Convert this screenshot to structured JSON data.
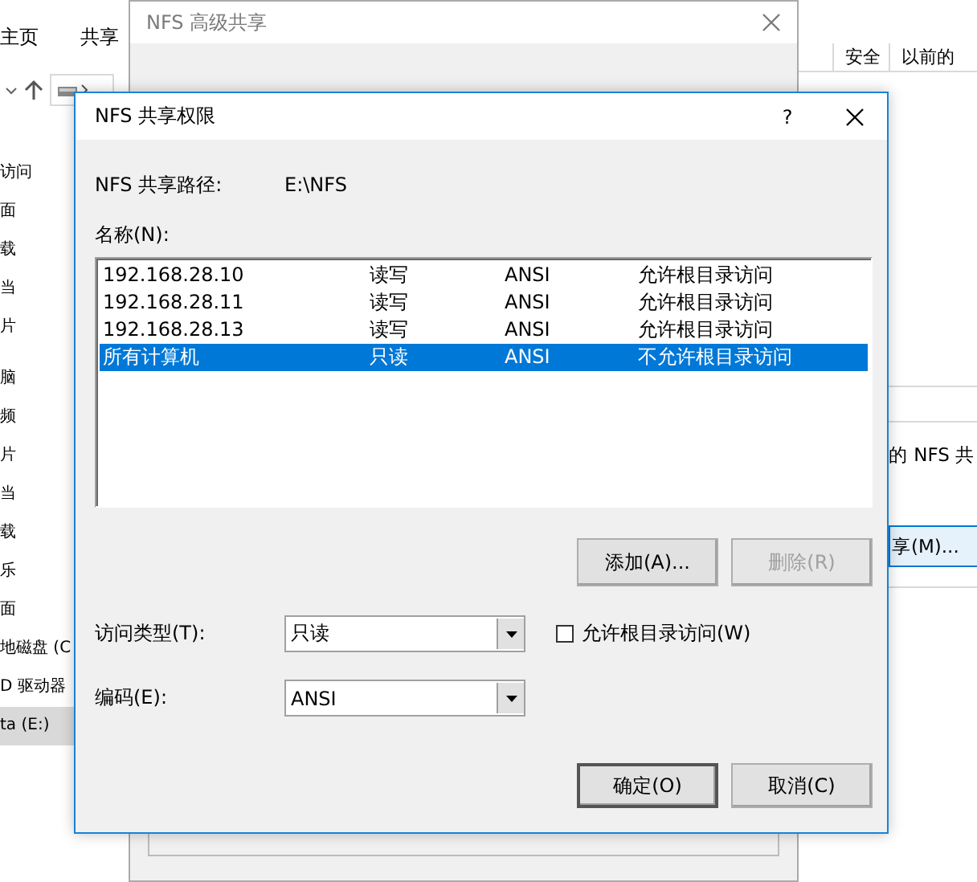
{
  "explorer": {
    "ribbon_tabs": [
      "主页",
      "共享"
    ],
    "nav_items": [
      {
        "label": "访问",
        "selected": false
      },
      {
        "label": "面",
        "selected": false
      },
      {
        "label": "载",
        "selected": false
      },
      {
        "label": "当",
        "selected": false
      },
      {
        "label": "片",
        "selected": false
      },
      {
        "label": "脑",
        "selected": false
      },
      {
        "label": "频",
        "selected": false
      },
      {
        "label": "片",
        "selected": false
      },
      {
        "label": "当",
        "selected": false
      },
      {
        "label": "载",
        "selected": false
      },
      {
        "label": "乐",
        "selected": false
      },
      {
        "label": "面",
        "selected": false
      },
      {
        "label": "地磁盘 (C",
        "selected": false
      },
      {
        "label": "D 驱动器",
        "selected": false
      },
      {
        "label": "ta (E:)",
        "selected": true
      }
    ]
  },
  "properties_window": {
    "tabs": [
      "安全",
      "以前的"
    ],
    "text": "的 NFS 共",
    "button": "享(M)..."
  },
  "advanced_window": {
    "title": "NFS 高级共享",
    "active": false
  },
  "dialog": {
    "title": "NFS 共享权限",
    "help": "?",
    "path_label": "NFS 共享路径:",
    "path": "E:\\NFS",
    "list_label": "名称(N):",
    "entries": [
      {
        "name": "192.168.28.10",
        "access": "读写",
        "encoding": "ANSI",
        "root": "允许根目录访问",
        "selected": false
      },
      {
        "name": "192.168.28.11",
        "access": "读写",
        "encoding": "ANSI",
        "root": "允许根目录访问",
        "selected": false
      },
      {
        "name": "192.168.28.13",
        "access": "读写",
        "encoding": "ANSI",
        "root": "允许根目录访问",
        "selected": false
      },
      {
        "name": "所有计算机",
        "access": "只读",
        "encoding": "ANSI",
        "root": "不允许根目录访问",
        "selected": true
      }
    ],
    "list_buttons": [
      {
        "label": "添加(A)...",
        "disabled": false
      },
      {
        "label": "删除(R)",
        "disabled": true
      }
    ],
    "access_type": {
      "label": "访问类型(T):",
      "value": "只读"
    },
    "allow_root": {
      "label": "允许根目录访问(W)",
      "checked": false
    },
    "encoding": {
      "label": "编码(E):",
      "value": "ANSI"
    },
    "buttons": [
      {
        "label": "确定(O)",
        "default": true
      },
      {
        "label": "取消(C)",
        "default": false
      }
    ]
  }
}
